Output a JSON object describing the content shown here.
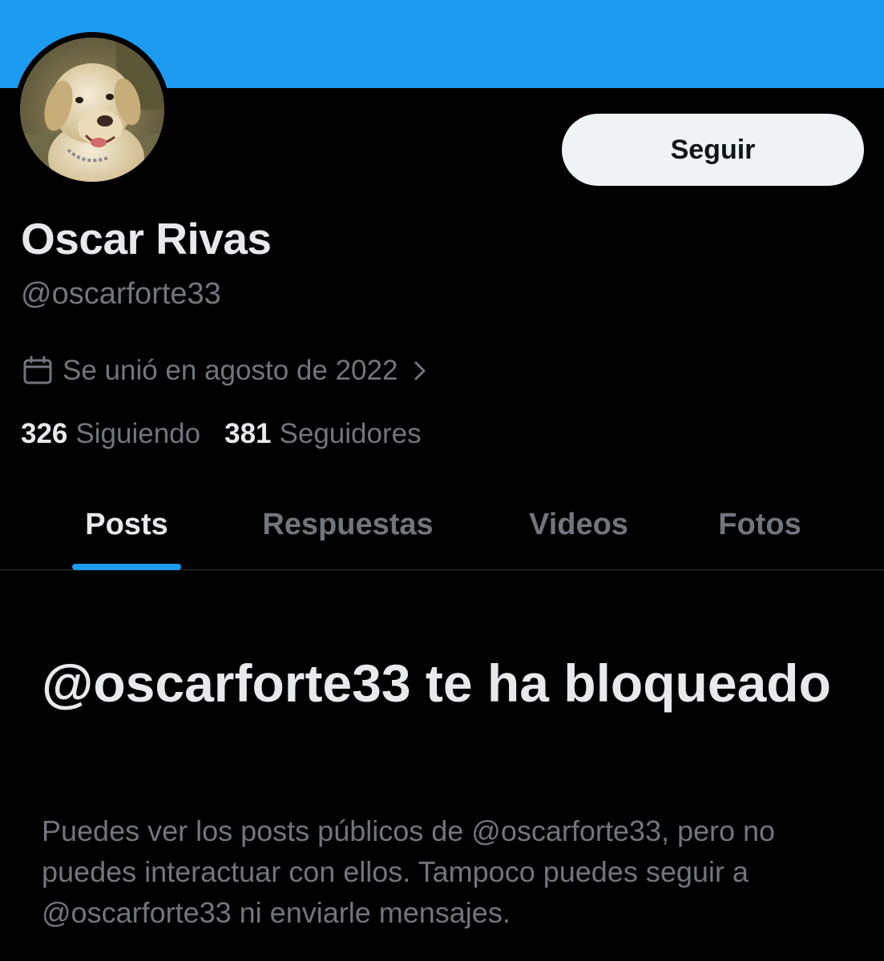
{
  "profile": {
    "display_name": "Oscar Rivas",
    "handle": "@oscarforte33",
    "joined": "Se unió en agosto de 2022",
    "following_count": "326",
    "following_label": "Siguiendo",
    "followers_count": "381",
    "followers_label": "Seguidores"
  },
  "actions": {
    "follow_label": "Seguir"
  },
  "tabs": [
    {
      "label": "Posts",
      "active": true
    },
    {
      "label": "Respuestas",
      "active": false
    },
    {
      "label": "Videos",
      "active": false
    },
    {
      "label": "Fotos",
      "active": false
    }
  ],
  "blocked_notice": {
    "title": "@oscarforte33 te ha bloqueado",
    "body": "Puedes ver los posts públicos de @oscarforte33, pero no puedes interactuar con ellos. Tampoco puedes seguir a @oscarforte33 ni enviarle mensajes."
  },
  "icons": {
    "joined": "calendar-icon",
    "joined_more": "chevron-right-icon"
  },
  "colors": {
    "accent": "#1d9bf0",
    "background": "#000000",
    "primary_text": "#e7e9ea",
    "secondary_text": "#71767b",
    "button_bg": "#eff3f4"
  }
}
